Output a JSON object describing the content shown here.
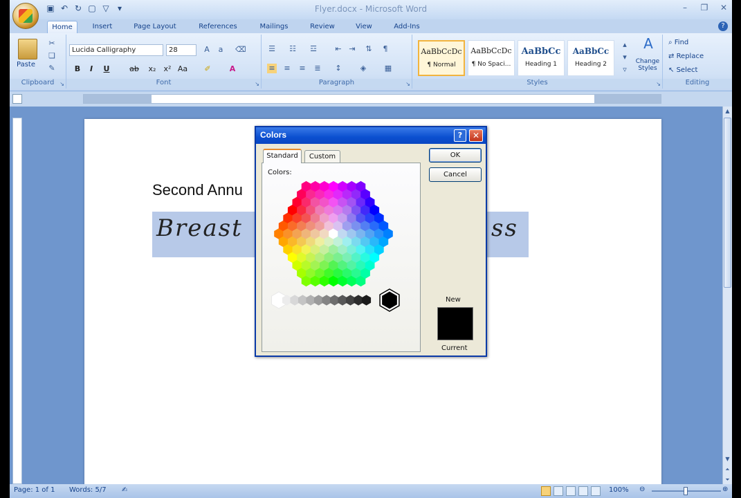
{
  "window": {
    "title": "Flyer.docx - Microsoft Word"
  },
  "ribbon": {
    "tabs": [
      "Home",
      "Insert",
      "Page Layout",
      "References",
      "Mailings",
      "Review",
      "View",
      "Add-Ins"
    ],
    "active_tab": "Home",
    "clipboard": {
      "paste_label": "Paste",
      "group_label": "Clipboard"
    },
    "font": {
      "family": "Lucida Calligraphy",
      "size": "28",
      "group_label": "Font"
    },
    "paragraph": {
      "group_label": "Paragraph"
    },
    "styles": {
      "group_label": "Styles",
      "items": [
        {
          "sample": "AaBbCcDc",
          "name": "¶ Normal"
        },
        {
          "sample": "AaBbCcDc",
          "name": "¶ No Spaci..."
        },
        {
          "sample": "AaBbCc",
          "name": "Heading 1"
        },
        {
          "sample": "AaBbCc",
          "name": "Heading 2"
        }
      ],
      "change_styles_label": "Change Styles"
    },
    "editing": {
      "group_label": "Editing",
      "find": "Find",
      "replace": "Replace",
      "select": "Select"
    }
  },
  "document": {
    "line1": "Second Annu",
    "line2_left": "Breast",
    "line2_right": "ss",
    "highlight_color": "#b7c9e8"
  },
  "dialog": {
    "title": "Colors",
    "tabs": [
      "Standard",
      "Custom"
    ],
    "active_tab": "Standard",
    "colors_label": "Colors:",
    "ok_label": "OK",
    "cancel_label": "Cancel",
    "new_label": "New",
    "current_label": "Current",
    "new_color": "#000000"
  },
  "statusbar": {
    "page": "Page: 1 of 1",
    "words": "Words: 5/7",
    "zoom": "100%"
  }
}
